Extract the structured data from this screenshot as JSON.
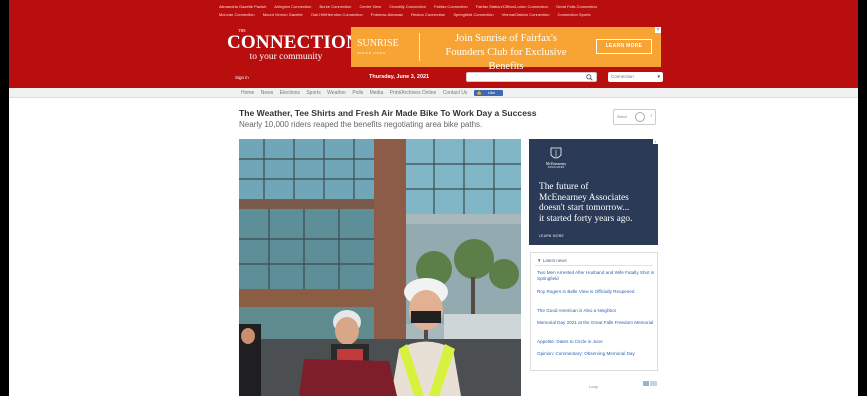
{
  "header": {
    "top_links_row1": [
      "Alexandria Gazette Packet",
      "Arlington Connection",
      "Burke Connection",
      "Centre View",
      "Chantilly Connection",
      "Fairfax Connection",
      "Fairfax Station/Clifton/Lorton Connection",
      "Great Falls Connection"
    ],
    "top_links_row2": [
      "McLean Connection",
      "Mount Vernon Gazette",
      "Oak Hill/Herndon Connection",
      "Potomac Almanac",
      "Reston Connection",
      "Springfield Connection",
      "Vienna/Oakton Connection",
      "Connection Sports"
    ],
    "logo_small": "THE",
    "logo_main": "CONNECTION",
    "logo_tagline": "to your community",
    "signin": "Sign in",
    "date": "Thursday, June 3, 2021",
    "search_icon": "search-icon",
    "edition_value": "Connection"
  },
  "banner_ad": {
    "brand": "SUNRISE",
    "brand_sub": "SENIOR LIVING",
    "line1": "Join Sunrise of Fairfax's",
    "line2": "Founders Club for Exclusive Benefits",
    "cta": "LEARN MORE",
    "color": "#f7a434"
  },
  "nav": {
    "items": [
      "Home",
      "News",
      "Elections",
      "Sports",
      "Weather",
      "Polls",
      "Media",
      "Print/Archives Online",
      "Contact Us"
    ],
    "fb_like": "Like"
  },
  "article": {
    "headline": "The Weather, Tee Shirts and Fresh Air Made Bike To Work Day a Success",
    "subhead": "Nearly 10,000 riders reaped the benefits negotiating area bike paths.",
    "share_label": "Select"
  },
  "side_ad": {
    "logo_name": "McEnearney",
    "logo_sub": "ASSOCIATES",
    "copy_lines": [
      "The future of",
      "McEnearney Associates",
      "doesn't start tomorrow...",
      "it started forty years ago."
    ],
    "learn": "LEARN MORE",
    "color": "#2b3a57"
  },
  "latest_news": {
    "title": "▼ Latest news",
    "items": [
      "Two Men Arrested After Husband and Wife Fatally Shot in Springfield",
      "Roy Rogers in Belle View is Officially Reopened",
      "The Good American is Also a Neighbor",
      "Memorial Day 2021 at the Great Falls Freedom Memorial",
      "Appetite: Dates to Circle in June",
      "Opinion: Commentary: Observing Memorial Day"
    ]
  },
  "bottom_ad": {
    "label": "Loop"
  },
  "colors": {
    "header_red": "#b90e0e",
    "link_blue": "#2a64b0"
  }
}
